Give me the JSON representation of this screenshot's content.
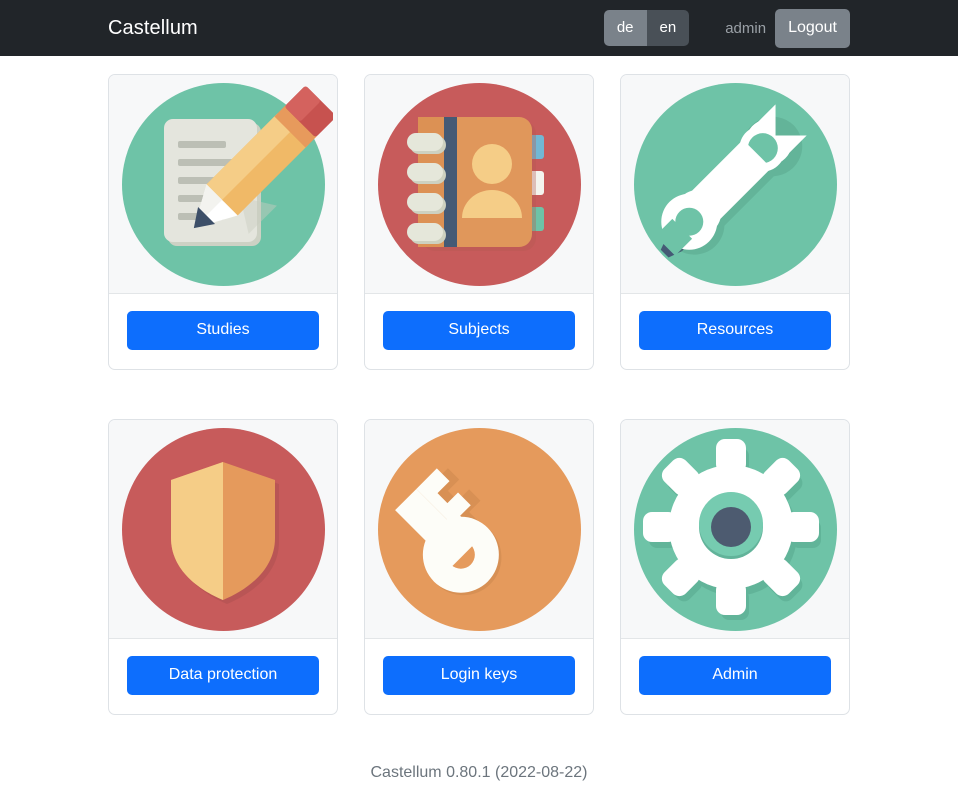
{
  "header": {
    "brand": "Castellum",
    "lang_de": "de",
    "lang_en": "en",
    "user": "admin",
    "logout": "Logout"
  },
  "cards": [
    {
      "label": "Studies",
      "icon": "document-pencil-icon",
      "circle_color": "#6ec3a7"
    },
    {
      "label": "Subjects",
      "icon": "address-book-icon",
      "circle_color": "#c75b5b"
    },
    {
      "label": "Resources",
      "icon": "wrench-screwdriver-icon",
      "circle_color": "#6ec3a7"
    },
    {
      "label": "Data protection",
      "icon": "shield-icon",
      "circle_color": "#c75b5b"
    },
    {
      "label": "Login keys",
      "icon": "key-icon",
      "circle_color": "#e59a5c"
    },
    {
      "label": "Admin",
      "icon": "gear-icon",
      "circle_color": "#6ec3a7"
    }
  ],
  "footer": {
    "text": "Castellum 0.80.1 (2022-08-22)"
  },
  "colors": {
    "navbar_bg": "#212529",
    "primary": "#0d6efd",
    "secondary": "#7a828a",
    "muted": "#6c757d"
  }
}
